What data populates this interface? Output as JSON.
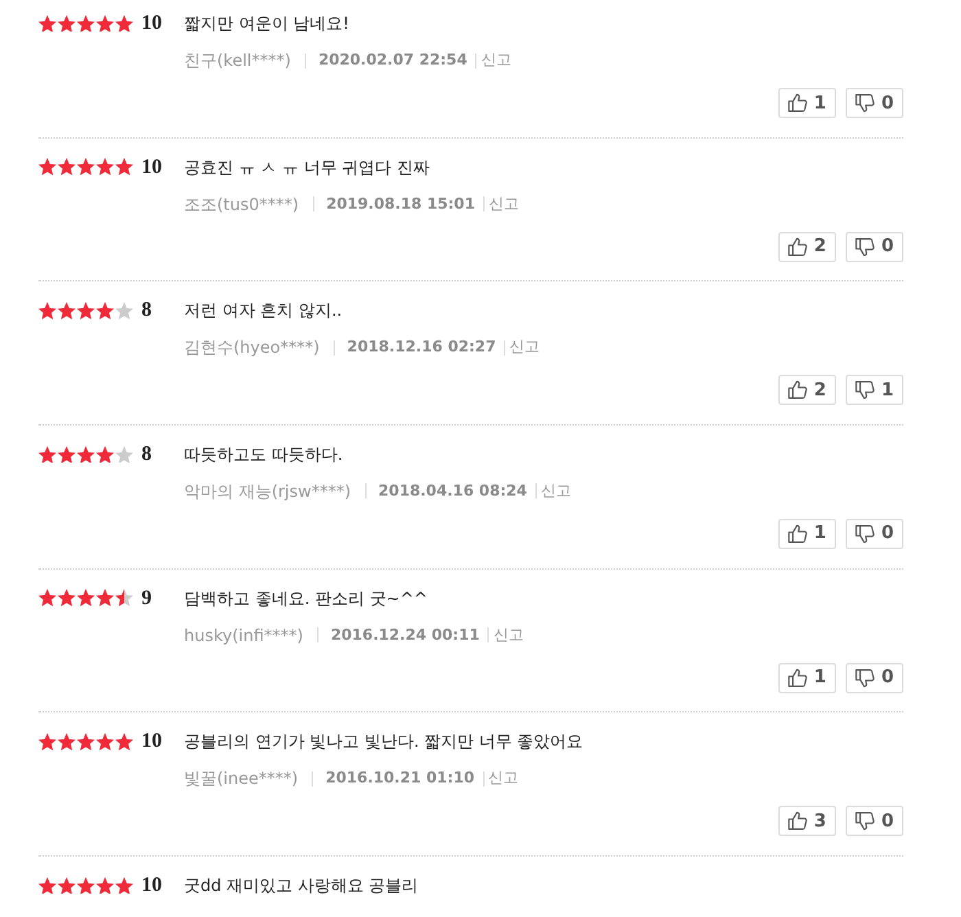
{
  "reviews": [
    {
      "stars": 5,
      "score": "10",
      "comment": "짧지만 여운이 남네요!",
      "author": "친구(kell****)",
      "date": "2020.02.07 22:54",
      "report": "신고",
      "likes": "1",
      "dislikes": "0"
    },
    {
      "stars": 5,
      "score": "10",
      "comment": "공효진 ㅠ ㅅ ㅠ 너무 귀엽다 진짜",
      "author": "조조(tus0****)",
      "date": "2019.08.18 15:01",
      "report": "신고",
      "likes": "2",
      "dislikes": "0"
    },
    {
      "stars": 4,
      "score": "8",
      "comment": "저런 여자 흔치 않지..",
      "author": "김현수(hyeo****)",
      "date": "2018.12.16 02:27",
      "report": "신고",
      "likes": "2",
      "dislikes": "1"
    },
    {
      "stars": 4,
      "score": "8",
      "comment": "따듯하고도 따듯하다.",
      "author": "악마의 재능(rjsw****)",
      "date": "2018.04.16 08:24",
      "report": "신고",
      "likes": "1",
      "dislikes": "0"
    },
    {
      "stars": 4.5,
      "score": "9",
      "comment": "담백하고 좋네요. 판소리 굿~^^",
      "author": "husky(infi****)",
      "date": "2016.12.24 00:11",
      "report": "신고",
      "likes": "1",
      "dislikes": "0"
    },
    {
      "stars": 5,
      "score": "10",
      "comment": "공블리의 연기가 빛나고 빛난다. 짧지만 너무 좋았어요",
      "author": "빛꿀(inee****)",
      "date": "2016.10.21 01:10",
      "report": "신고",
      "likes": "3",
      "dislikes": "0"
    },
    {
      "stars": 5,
      "score": "10",
      "comment": "굿dd 재미있고 사랑해요 공블리"
    }
  ]
}
